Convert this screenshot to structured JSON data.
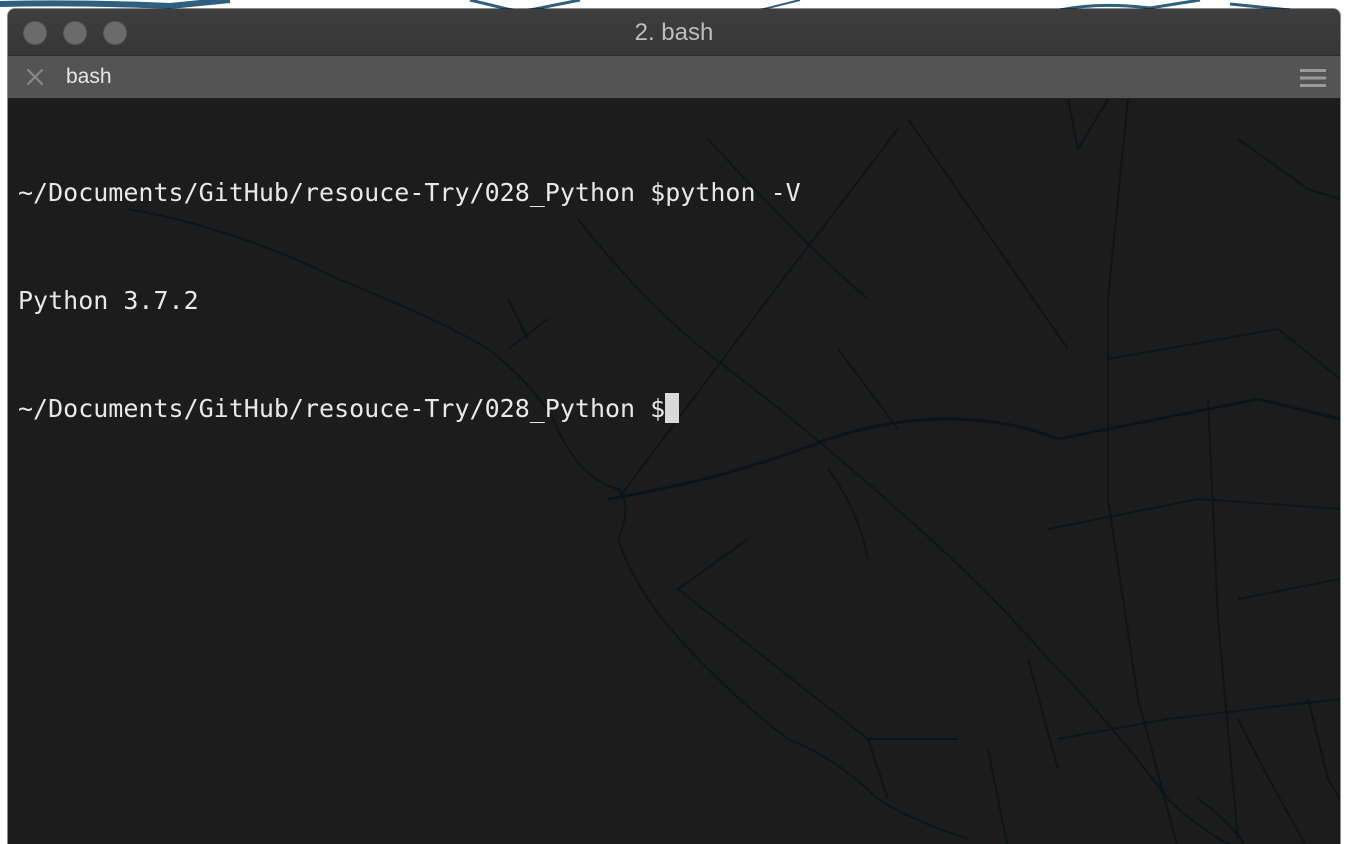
{
  "window": {
    "title": "2. bash"
  },
  "tab": {
    "label": "bash"
  },
  "terminal": {
    "lines": [
      "~/Documents/GitHub/resouce-Try/028_Python $python -V",
      "Python 3.7.2"
    ],
    "prompt": "~/Documents/GitHub/resouce-Try/028_Python $"
  },
  "icons": {
    "tab_close": "close-x-icon",
    "tab_menu": "hamburger-menu-icon"
  },
  "colors": {
    "terminal_background": "#1c1c1c",
    "terminal_text": "#e8e8e8",
    "titlebar": "#3a3a3a",
    "tabbar": "#545454",
    "map_lines": "#0a1418"
  }
}
